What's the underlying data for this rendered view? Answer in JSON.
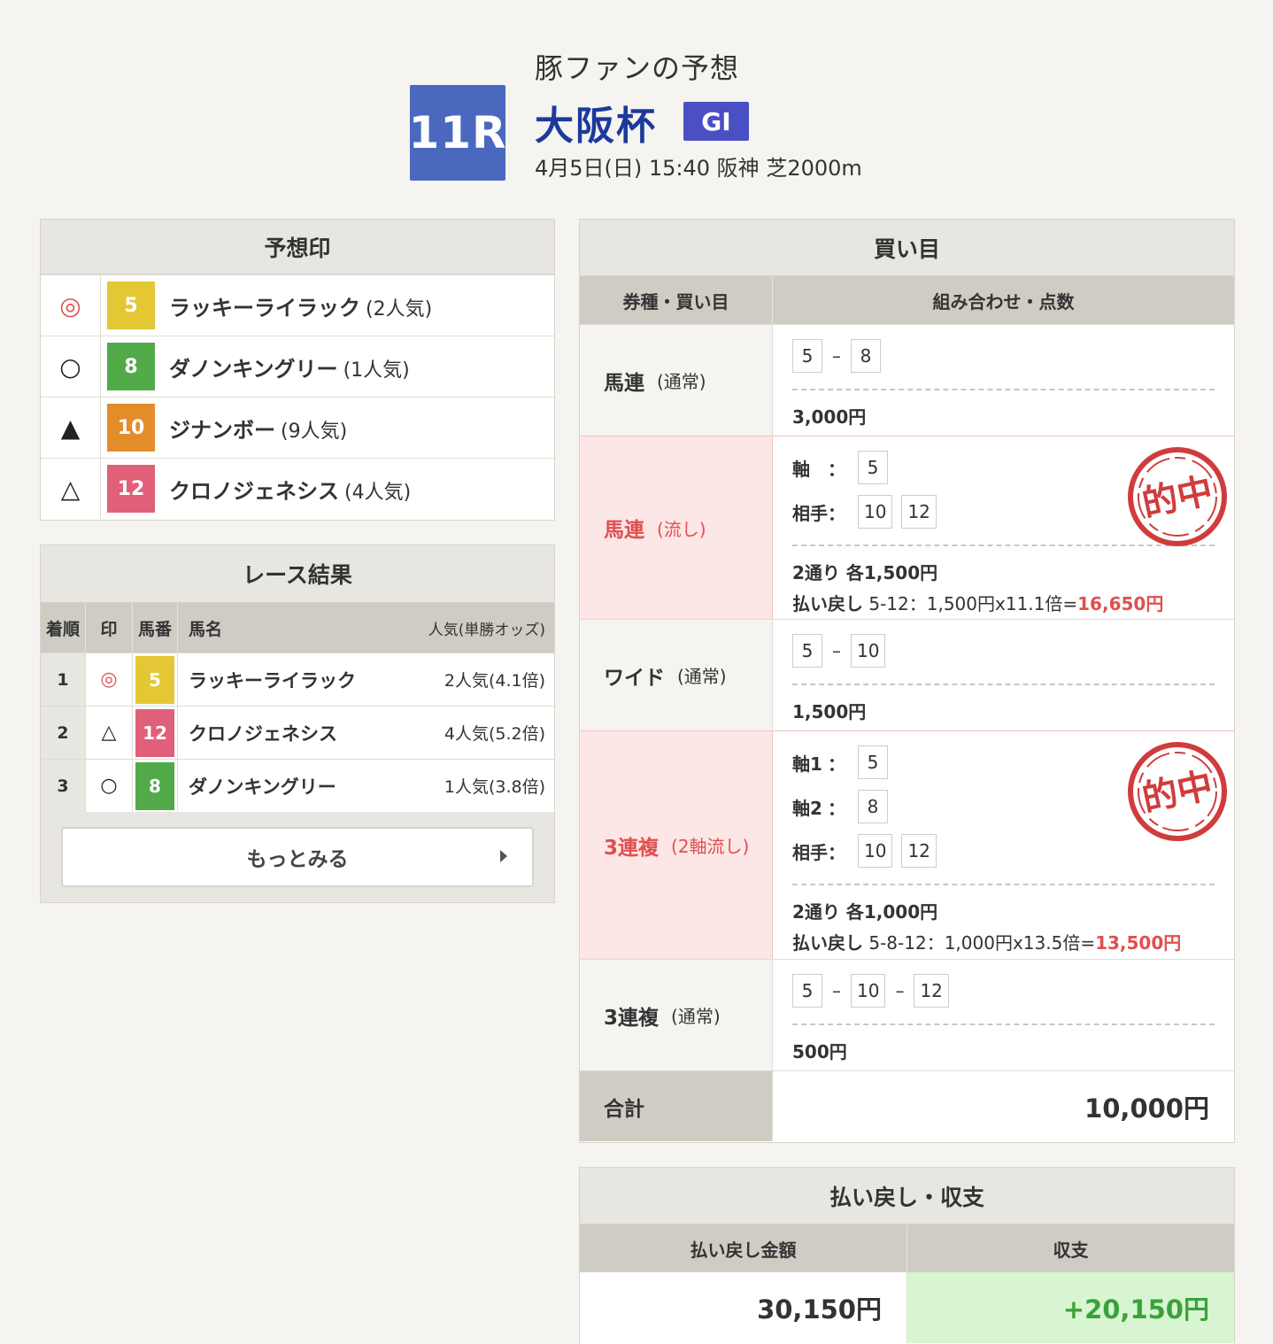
{
  "header": {
    "subtitle": "豚ファンの予想",
    "race_no": "11R",
    "race_name": "大阪杯",
    "grade": "GI",
    "info": "4月5日(日) 15:40 阪神 芝2000m"
  },
  "prediction": {
    "title": "予想印",
    "rows": [
      {
        "mark": "◎",
        "num": "5",
        "name": "ラッキーライラック",
        "pop": "(2人気)"
      },
      {
        "mark": "○",
        "num": "8",
        "name": "ダノンキングリー",
        "pop": "(1人気)"
      },
      {
        "mark": "▲",
        "num": "10",
        "name": "ジナンボー",
        "pop": "(9人気)"
      },
      {
        "mark": "△",
        "num": "12",
        "name": "クロノジェネシス",
        "pop": "(4人気)"
      }
    ]
  },
  "results": {
    "title": "レース結果",
    "headers": {
      "rank": "着順",
      "mark": "印",
      "num": "馬番",
      "name": "馬名",
      "odds": "人気(単勝オッズ)"
    },
    "rows": [
      {
        "rank": "1",
        "mark": "◎",
        "num": "5",
        "name": "ラッキーライラック",
        "odds": "2人気(4.1倍)"
      },
      {
        "rank": "2",
        "mark": "△",
        "num": "12",
        "name": "クロノジェネシス",
        "odds": "4人気(5.2倍)"
      },
      {
        "rank": "3",
        "mark": "○",
        "num": "8",
        "name": "ダノンキングリー",
        "odds": "1人気(3.8倍)"
      }
    ],
    "more_label": "もっとみる"
  },
  "bets": {
    "title": "買い目",
    "headers": {
      "type": "券種・買い目",
      "combo": "組み合わせ・点数"
    },
    "stamp_text": "的中",
    "rows": [
      {
        "type": "馬連",
        "sub": "(通常)",
        "boxes": [
          "5",
          "8"
        ],
        "amount": "3,000円"
      },
      {
        "type": "馬連",
        "sub": "(流し)",
        "axis_label": "軸",
        "axis": [
          "5"
        ],
        "partner_label": "相手",
        "partners": [
          "10",
          "12"
        ],
        "amount": "2通り 各1,500円",
        "payout_label": "払い戻し",
        "payout_calc": "5-12：1,500円x11.1倍=",
        "payout_value": "16,650円"
      },
      {
        "type": "ワイド",
        "sub": "(通常)",
        "boxes": [
          "5",
          "10"
        ],
        "amount": "1,500円"
      },
      {
        "type": "3連複",
        "sub": "(2軸流し)",
        "axis1_label": "軸1",
        "axis1": [
          "5"
        ],
        "axis2_label": "軸2",
        "axis2": [
          "8"
        ],
        "partner_label": "相手",
        "partners": [
          "10",
          "12"
        ],
        "amount": "2通り 各1,000円",
        "payout_label": "払い戻し",
        "payout_calc": "5-8-12：1,000円x13.5倍=",
        "payout_value": "13,500円"
      },
      {
        "type": "3連複",
        "sub": "(通常)",
        "boxes": [
          "5",
          "10",
          "12"
        ],
        "amount": "500円"
      }
    ],
    "total_label": "合計",
    "total_value": "10,000円"
  },
  "refund": {
    "title": "払い戻し・収支",
    "headers": {
      "amount": "払い戻し金額",
      "balance": "収支"
    },
    "amount": "30,150円",
    "balance": "+20,150円"
  },
  "colors": {
    "race_no_bg": "#4a68bd",
    "race_name": "#1c3a9c",
    "grade_bg": "#4b4fc4",
    "hit_red": "#e05050",
    "positive_green": "#3aa23a",
    "num_5": "#e3c735",
    "num_8": "#52aa49",
    "num_10": "#e38d2a",
    "num_12": "#e06079"
  }
}
